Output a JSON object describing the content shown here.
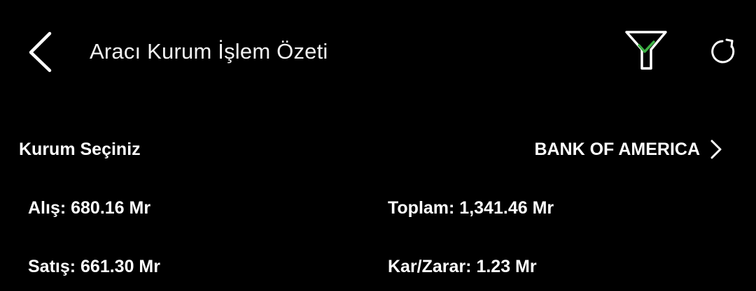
{
  "header": {
    "title": "Aracı Kurum İşlem Özeti",
    "back_icon": "chevron-left-icon",
    "filter_icon": "filter-check-icon",
    "refresh_icon": "refresh-icon"
  },
  "institution": {
    "label": "Kurum Seçiniz",
    "value": "BANK OF AMERICA",
    "chevron_icon": "chevron-right-icon"
  },
  "stats": {
    "buy": "Alış: 680.16 Mr",
    "sell": "Satış: 661.30 Mr",
    "total": "Toplam: 1,341.46 Mr",
    "profit_loss": "Kar/Zarar: 1.23 Mr"
  },
  "colors": {
    "background": "#000000",
    "text": "#ffffff",
    "accent_check": "#3cb043"
  }
}
